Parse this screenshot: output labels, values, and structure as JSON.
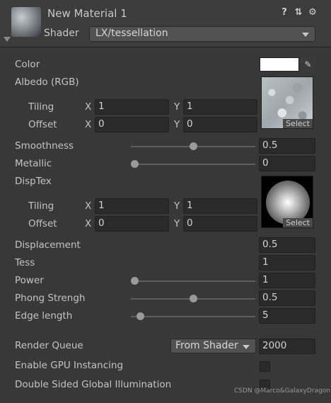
{
  "header": {
    "title": "New Material 1",
    "shader_label": "Shader",
    "shader_value": "LX/tessellation",
    "icons": [
      "help-icon",
      "preset-icon",
      "settings-icon"
    ]
  },
  "properties": {
    "color_label": "Color",
    "color_value": "#ffffff",
    "albedo_label": "Albedo (RGB)",
    "albedo_tiling_label": "Tiling",
    "albedo_tiling_x": "1",
    "albedo_tiling_y": "1",
    "albedo_offset_label": "Offset",
    "albedo_offset_x": "0",
    "albedo_offset_y": "0",
    "smoothness_label": "Smoothness",
    "smoothness_value": "0.5",
    "metallic_label": "Metallic",
    "metallic_value": "0",
    "disptex_label": "DispTex",
    "disp_tiling_label": "Tiling",
    "disp_tiling_x": "1",
    "disp_tiling_y": "1",
    "disp_offset_label": "Offset",
    "disp_offset_x": "0",
    "disp_offset_y": "0",
    "displacement_label": "Displacement",
    "displacement_value": "0.5",
    "tess_label": "Tess",
    "tess_value": "1",
    "power_label": "Power",
    "power_value": "1",
    "phong_label": "Phong Strengh",
    "phong_value": "0.5",
    "edge_label": "Edge length",
    "edge_value": "5",
    "axis_x": "X",
    "axis_y": "Y",
    "select_label": "Select"
  },
  "sliders": {
    "smoothness_fraction": 0.5,
    "metallic_fraction": 0.0,
    "power_fraction": 0.0,
    "phong_fraction": 0.5,
    "edge_fraction": 0.05
  },
  "footer": {
    "render_queue_label": "Render Queue",
    "render_queue_mode": "From Shader",
    "render_queue_value": "2000",
    "gpu_instancing_label": "Enable GPU Instancing",
    "double_sided_gi_label": "Double Sided Global Illumination",
    "watermark": "CSDN @Marco&GalaxyDragon"
  }
}
